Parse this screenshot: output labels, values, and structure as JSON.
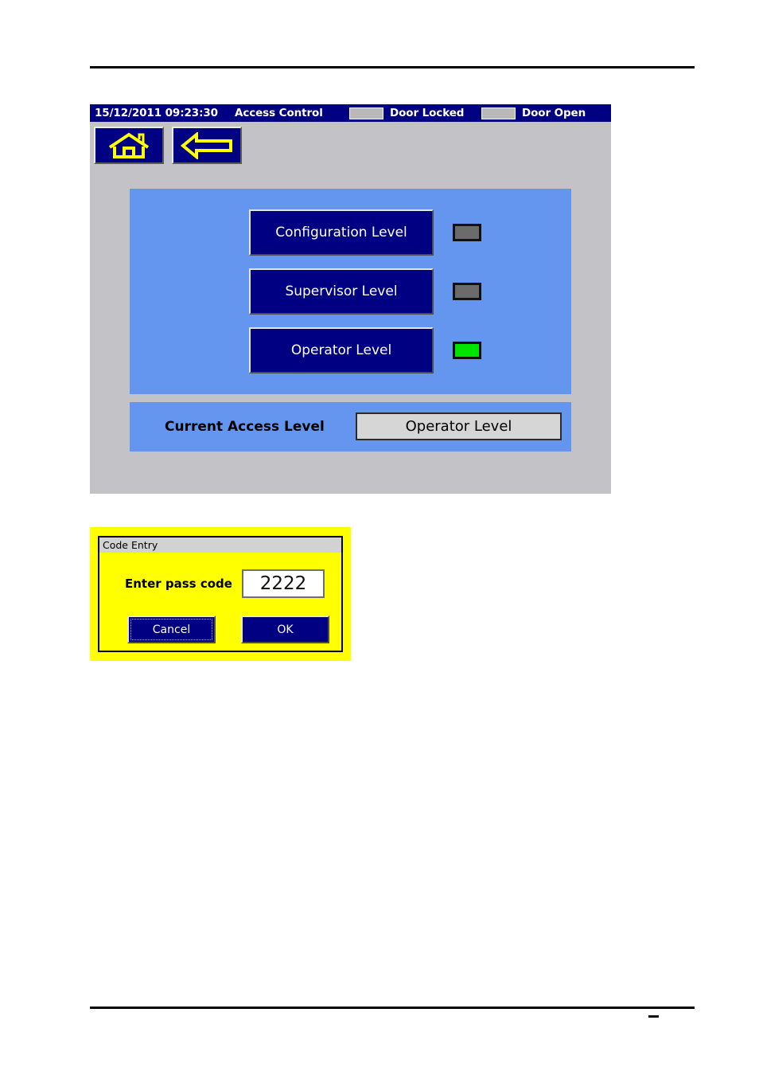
{
  "hmi": {
    "titlebar": {
      "datetime": "15/12/2011 09:23:30",
      "screen_name": "Access Control",
      "status": [
        {
          "name": "door-locked",
          "label": "Door Locked",
          "lamp_color": "#b9b9b9",
          "state": "off"
        },
        {
          "name": "door-open",
          "label": "Door Open",
          "lamp_color": "#b9b9b9",
          "state": "off"
        }
      ]
    },
    "nav": [
      {
        "name": "home-button",
        "icon": "home-icon"
      },
      {
        "name": "back-button",
        "icon": "left-arrow-icon"
      }
    ],
    "access_levels": [
      {
        "label": "Configuration Level",
        "lamp_color": "#6b6b6b",
        "active": false
      },
      {
        "label": "Supervisor Level",
        "lamp_color": "#6b6b6b",
        "active": false
      },
      {
        "label": "Operator Level",
        "lamp_color": "#00e400",
        "active": true
      }
    ],
    "current_access": {
      "label": "Current Access Level",
      "value": "Operator Level"
    },
    "colors": {
      "titlebar_blue": "#000082",
      "panel_blue": "#6596ef",
      "screen_gray": "#c3c3c7",
      "button_blue": "#000082",
      "lamp_on_green": "#00e400",
      "lamp_off_gray": "#6b6b6b"
    }
  },
  "code_dialog": {
    "title": "Code Entry",
    "field_label": "Enter pass code",
    "pass_code_value": "2222",
    "pass_code_placeholder": "",
    "buttons": [
      {
        "name": "cancel-button",
        "label": "Cancel",
        "focused": true
      },
      {
        "name": "ok-button",
        "label": "OK",
        "focused": false
      }
    ],
    "colors": {
      "dialog_background": "#ffff00",
      "titlebar_gray": "#d2d2d2",
      "button_blue": "#000082"
    }
  }
}
